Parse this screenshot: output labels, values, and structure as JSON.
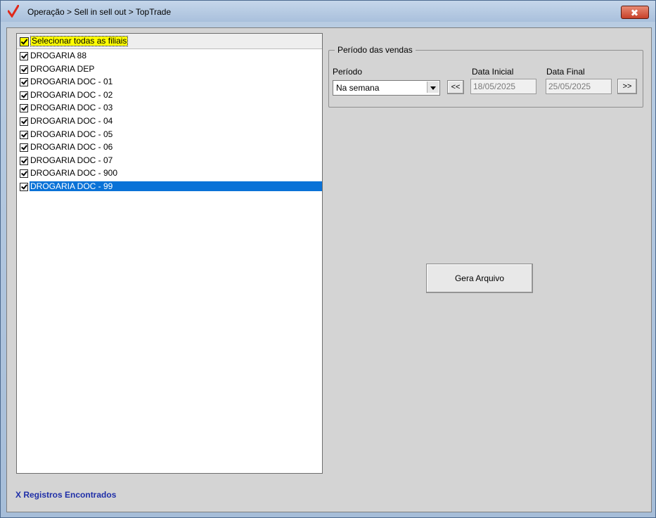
{
  "window": {
    "title": "Operação > Sell in sell out > TopTrade"
  },
  "list": {
    "select_all_label": "Selecionar todas as filiais",
    "items": [
      "DROGARIA 88",
      "DROGARIA DEP",
      "DROGARIA DOC - 01",
      "DROGARIA DOC - 02",
      "DROGARIA DOC - 03",
      "DROGARIA DOC - 04",
      "DROGARIA DOC - 05",
      "DROGARIA DOC - 06",
      "DROGARIA DOC - 07",
      "DROGARIA DOC - 900",
      "DROGARIA DOC - 99"
    ],
    "selected_index": 10
  },
  "periodo": {
    "group_title": "Período das vendas",
    "periodo_label": "Período",
    "periodo_value": "Na semana",
    "prev_label": "<<",
    "next_label": ">>",
    "data_inicial_label": "Data Inicial",
    "data_inicial_value": "18/05/2025",
    "data_final_label": "Data Final",
    "data_final_value": "25/05/2025"
  },
  "actions": {
    "gera_arquivo_label": "Gera Arquivo"
  },
  "status": {
    "found_label": "X Registros Encontrados"
  },
  "colors": {
    "selection": "#0a72d7",
    "highlight": "#ffff00",
    "status_text": "#1f2fa8"
  }
}
